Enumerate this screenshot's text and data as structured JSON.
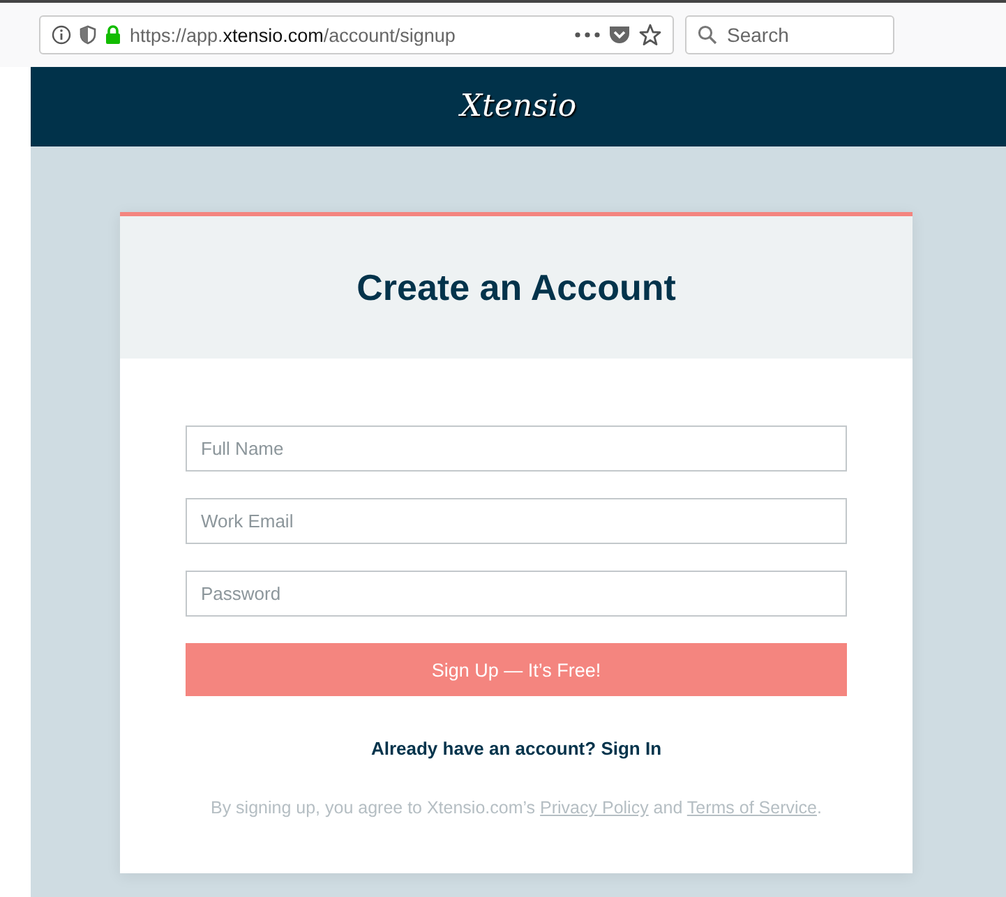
{
  "browser": {
    "url": "https://app.**xtensio.com**/account/signup",
    "search": {
      "placeholder": "Search"
    }
  },
  "header": {
    "logo": "Xtensio"
  },
  "card": {
    "title": "Create an Account",
    "fields": [
      {
        "placeholder": "Full Name"
      },
      {
        "placeholder": "Work Email"
      },
      {
        "placeholder": "Password"
      }
    ],
    "submit": "Sign Up — It’s Free!",
    "signin_link": "Already have an account? Sign In",
    "legal": {
      "before": "By signing up, you agree to Xtensio.com’s ",
      "privacy": "Privacy Policy",
      "middle": " and ",
      "terms": "Terms of Service",
      "after": "."
    }
  }
}
